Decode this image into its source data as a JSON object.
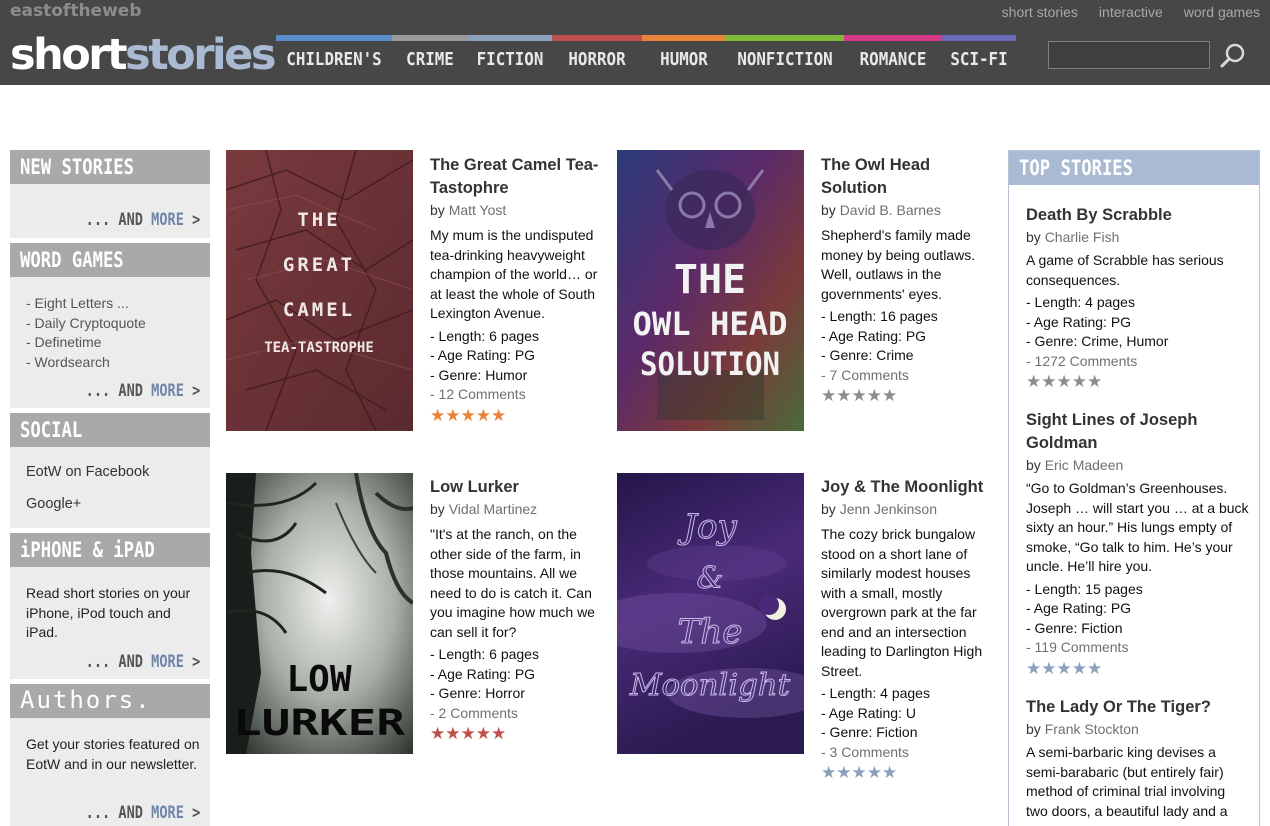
{
  "header": {
    "site_name": "eastoftheweb",
    "logo_part1": "short",
    "logo_part2": "stories",
    "top_links": [
      "short stories",
      "interactive",
      "word games"
    ],
    "nav": [
      {
        "label": "CHILDREN'S",
        "color": "#5b8ec9"
      },
      {
        "label": "CRIME",
        "color": "#9a9a9a"
      },
      {
        "label": "FICTION",
        "color": "#8aa0bb"
      },
      {
        "label": "HORROR",
        "color": "#c0504d"
      },
      {
        "label": "HUMOR",
        "color": "#e8843a"
      },
      {
        "label": "NONFICTION",
        "color": "#7fba3a"
      },
      {
        "label": "ROMANCE",
        "color": "#d63a86"
      },
      {
        "label": "SCI-FI",
        "color": "#6a6ab8"
      }
    ],
    "search_value": "",
    "search_icon": "search-icon"
  },
  "sidebar": {
    "new_stories": {
      "title": "NEW STORIES",
      "more_prefix": "... AND ",
      "more_word": "MORE",
      "more_arrow": ">"
    },
    "word_games": {
      "title": "WORD GAMES",
      "items": [
        "- Eight Letters ...",
        "- Daily Cryptoquote",
        "- Definetime",
        "- Wordsearch"
      ],
      "more_prefix": "... AND ",
      "more_word": "MORE",
      "more_arrow": ">"
    },
    "social": {
      "title": "SOCIAL",
      "facebook": "EotW on Facebook",
      "google": "Google+"
    },
    "iphone": {
      "title": "iPHONE & iPAD",
      "text": "Read short stories on your iPhone, iPod touch and iPad.",
      "more_prefix": "... AND ",
      "more_word": "MORE",
      "more_arrow": ">"
    },
    "authors": {
      "title": "Authors.",
      "text": "Get your stories featured on EotW and in our newsletter.",
      "more_prefix": "... AND ",
      "more_word": "MORE",
      "more_arrow": ">"
    }
  },
  "stories": [
    {
      "title": "The Great Camel Tea-Tastophre",
      "by": "by ",
      "author": "Matt Yost",
      "blurb": "My mum is the undisputed tea-drinking heavyweight champion of the world… or at least the whole of South Lexington Avenue.",
      "length": "- Length: 6 pages",
      "age": "- Age Rating: PG",
      "genre": "- Genre: Humor",
      "comments": "- 12 Comments",
      "stars": "★★★★★",
      "star_color": "#e8843a",
      "cover_lines": [
        "THE",
        "GREAT",
        "CAMEL",
        "TEA-TASTROPHE"
      ]
    },
    {
      "title": "The Owl Head Solution",
      "by": "by ",
      "author": "David B. Barnes",
      "blurb": "Shepherd's family made money by being outlaws. Well, outlaws in the governments' eyes.",
      "length": "- Length: 16 pages",
      "age": "- Age Rating: PG",
      "genre": "- Genre: Crime",
      "comments": "- 7 Comments",
      "stars": "★★★★★",
      "star_color": "#8c8c8c",
      "cover_lines": [
        "THE",
        "OWL HEAD",
        "SOLUTION"
      ]
    },
    {
      "title": "Low Lurker",
      "by": "by ",
      "author": "Vidal Martinez",
      "blurb": "\"It's at the ranch, on the other side of the farm, in those mountains. All we need to do is catch it. Can you imagine how much we can sell it for?",
      "length": "- Length: 6 pages",
      "age": "- Age Rating: PG",
      "genre": "- Genre: Horror",
      "comments": "- 2 Comments",
      "stars": "★★★★★",
      "star_color": "#c0504d",
      "cover_lines": [
        "LOW",
        "LURKER"
      ]
    },
    {
      "title": "Joy & The Moonlight",
      "by": "by ",
      "author": "Jenn Jenkinson",
      "blurb": "The cozy brick bungalow stood on a short lane of similarly modest houses with a small, mostly overgrown park at the far end and an intersection leading to Darlington High Street.",
      "length": "- Length: 4 pages",
      "age": "- Age Rating: U",
      "genre": "- Genre: Fiction",
      "comments": "- 3 Comments",
      "stars": "★★★★★",
      "star_color": "#8aa0bb",
      "cover_lines": [
        "Joy",
        "&",
        "The",
        "Moonlight"
      ]
    }
  ],
  "top_stories": {
    "title": "TOP STORIES",
    "items": [
      {
        "title": "Death By Scrabble",
        "by": "by ",
        "author": "Charlie Fish",
        "blurb": "A game of Scrabble has serious consequences.",
        "length": "- Length: 4 pages",
        "age": "- Age Rating: PG",
        "genre": "- Genre: Crime, Humor",
        "comments": "- 1272 Comments",
        "stars": "★★★★★",
        "star_color": "#8c8c8c"
      },
      {
        "title": "Sight Lines of Joseph Goldman",
        "by": "by ",
        "author": "Eric Madeen",
        "blurb": "“Go to Goldman’s Greenhouses. Joseph … will start you … at a buck sixty an hour.” His lungs empty of smoke, “Go talk to him. He’s your uncle. He’ll hire you.",
        "length": "- Length: 15 pages",
        "age": "- Age Rating: PG",
        "genre": "- Genre: Fiction",
        "comments": "- 119 Comments",
        "stars": "★★★★★",
        "star_color": "#8aa0bb"
      },
      {
        "title": "The Lady Or The Tiger?",
        "by": "by ",
        "author": "Frank Stockton",
        "blurb": "A semi-barbaric king devises a semi-barabaric (but entirely fair) method of criminal trial involving two doors, a beautiful lady and a"
      }
    ]
  }
}
